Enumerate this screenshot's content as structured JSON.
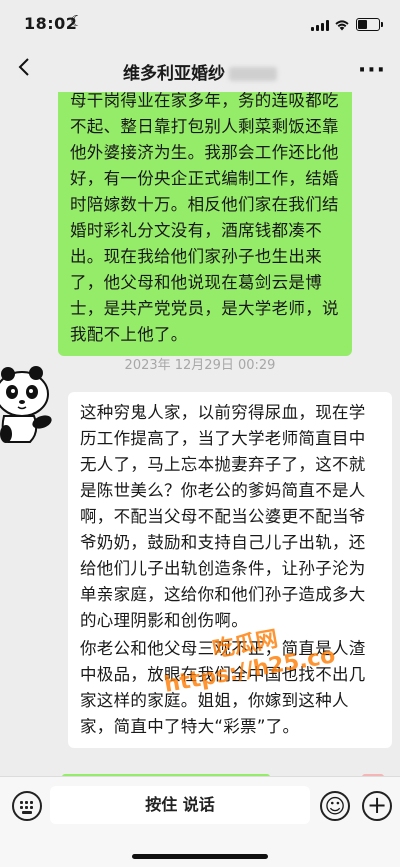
{
  "status_bar": {
    "time": "18:02",
    "moon_icon": "moon-icon",
    "wifi_icon": "wifi-icon",
    "battery_level": 0.5
  },
  "nav": {
    "title": "维多利亚婚纱",
    "back_icon": "chevron-left-icon",
    "more_icon": "more-dots-icon"
  },
  "messages": [
    {
      "side": "right",
      "color": "#95ec69",
      "text": "母干岗得业在家多年，务的连吸都吃不起、整日靠打包别人剩菜剩饭还靠他外婆接济为生。我那会工作还比他好，有一份央企正式编制工作，结婚时陪嫁数十万。相反他们家在我们结婚时彩礼分文没有，酒席钱都凑不出。现在我给他们家孙子也生出来了，他父母和他说现在葛剑云是博士，是共产党党员，是大学老师，说我配不上他了。"
    },
    {
      "side": "left",
      "timestamp": "2023年 12月29日 00:29",
      "avatar_icon": "panda-avatar-icon",
      "paragraphs": [
        "这种穷鬼人家，以前穷得尿血，现在学历工作提高了，当了大学老师简直目中无人了，马上忘本抛妻弃子了，这不就是陈世美么？你老公的爹妈简直不是人啊，不配当父母不配当公婆更不配当爷爷奶奶，鼓励和支持自己儿子出轨，还给他们儿子出轨创造条件，让孙子沦为单亲家庭，这给你和他们孙子造成多大的心理阴影和创伤啊。",
        "你老公和他父母三观不正，简直是人渣中极品，放眼在我们全中国也找不出几家这样的家庭。姐姐，你嫁到这种人家，简直中了特大“彩票”了。"
      ]
    }
  ],
  "watermark": {
    "line1": "吃瓜网",
    "line2": "https://h25.co"
  },
  "input_bar": {
    "keyboard_icon": "keyboard-icon",
    "hold_to_talk_label": "按住 说话",
    "emoji_icon": "emoji-icon",
    "plus_icon": "plus-icon"
  },
  "colors": {
    "sent_bubble": "#95ec69",
    "received_bubble": "#ffffff",
    "background": "#ededed"
  }
}
